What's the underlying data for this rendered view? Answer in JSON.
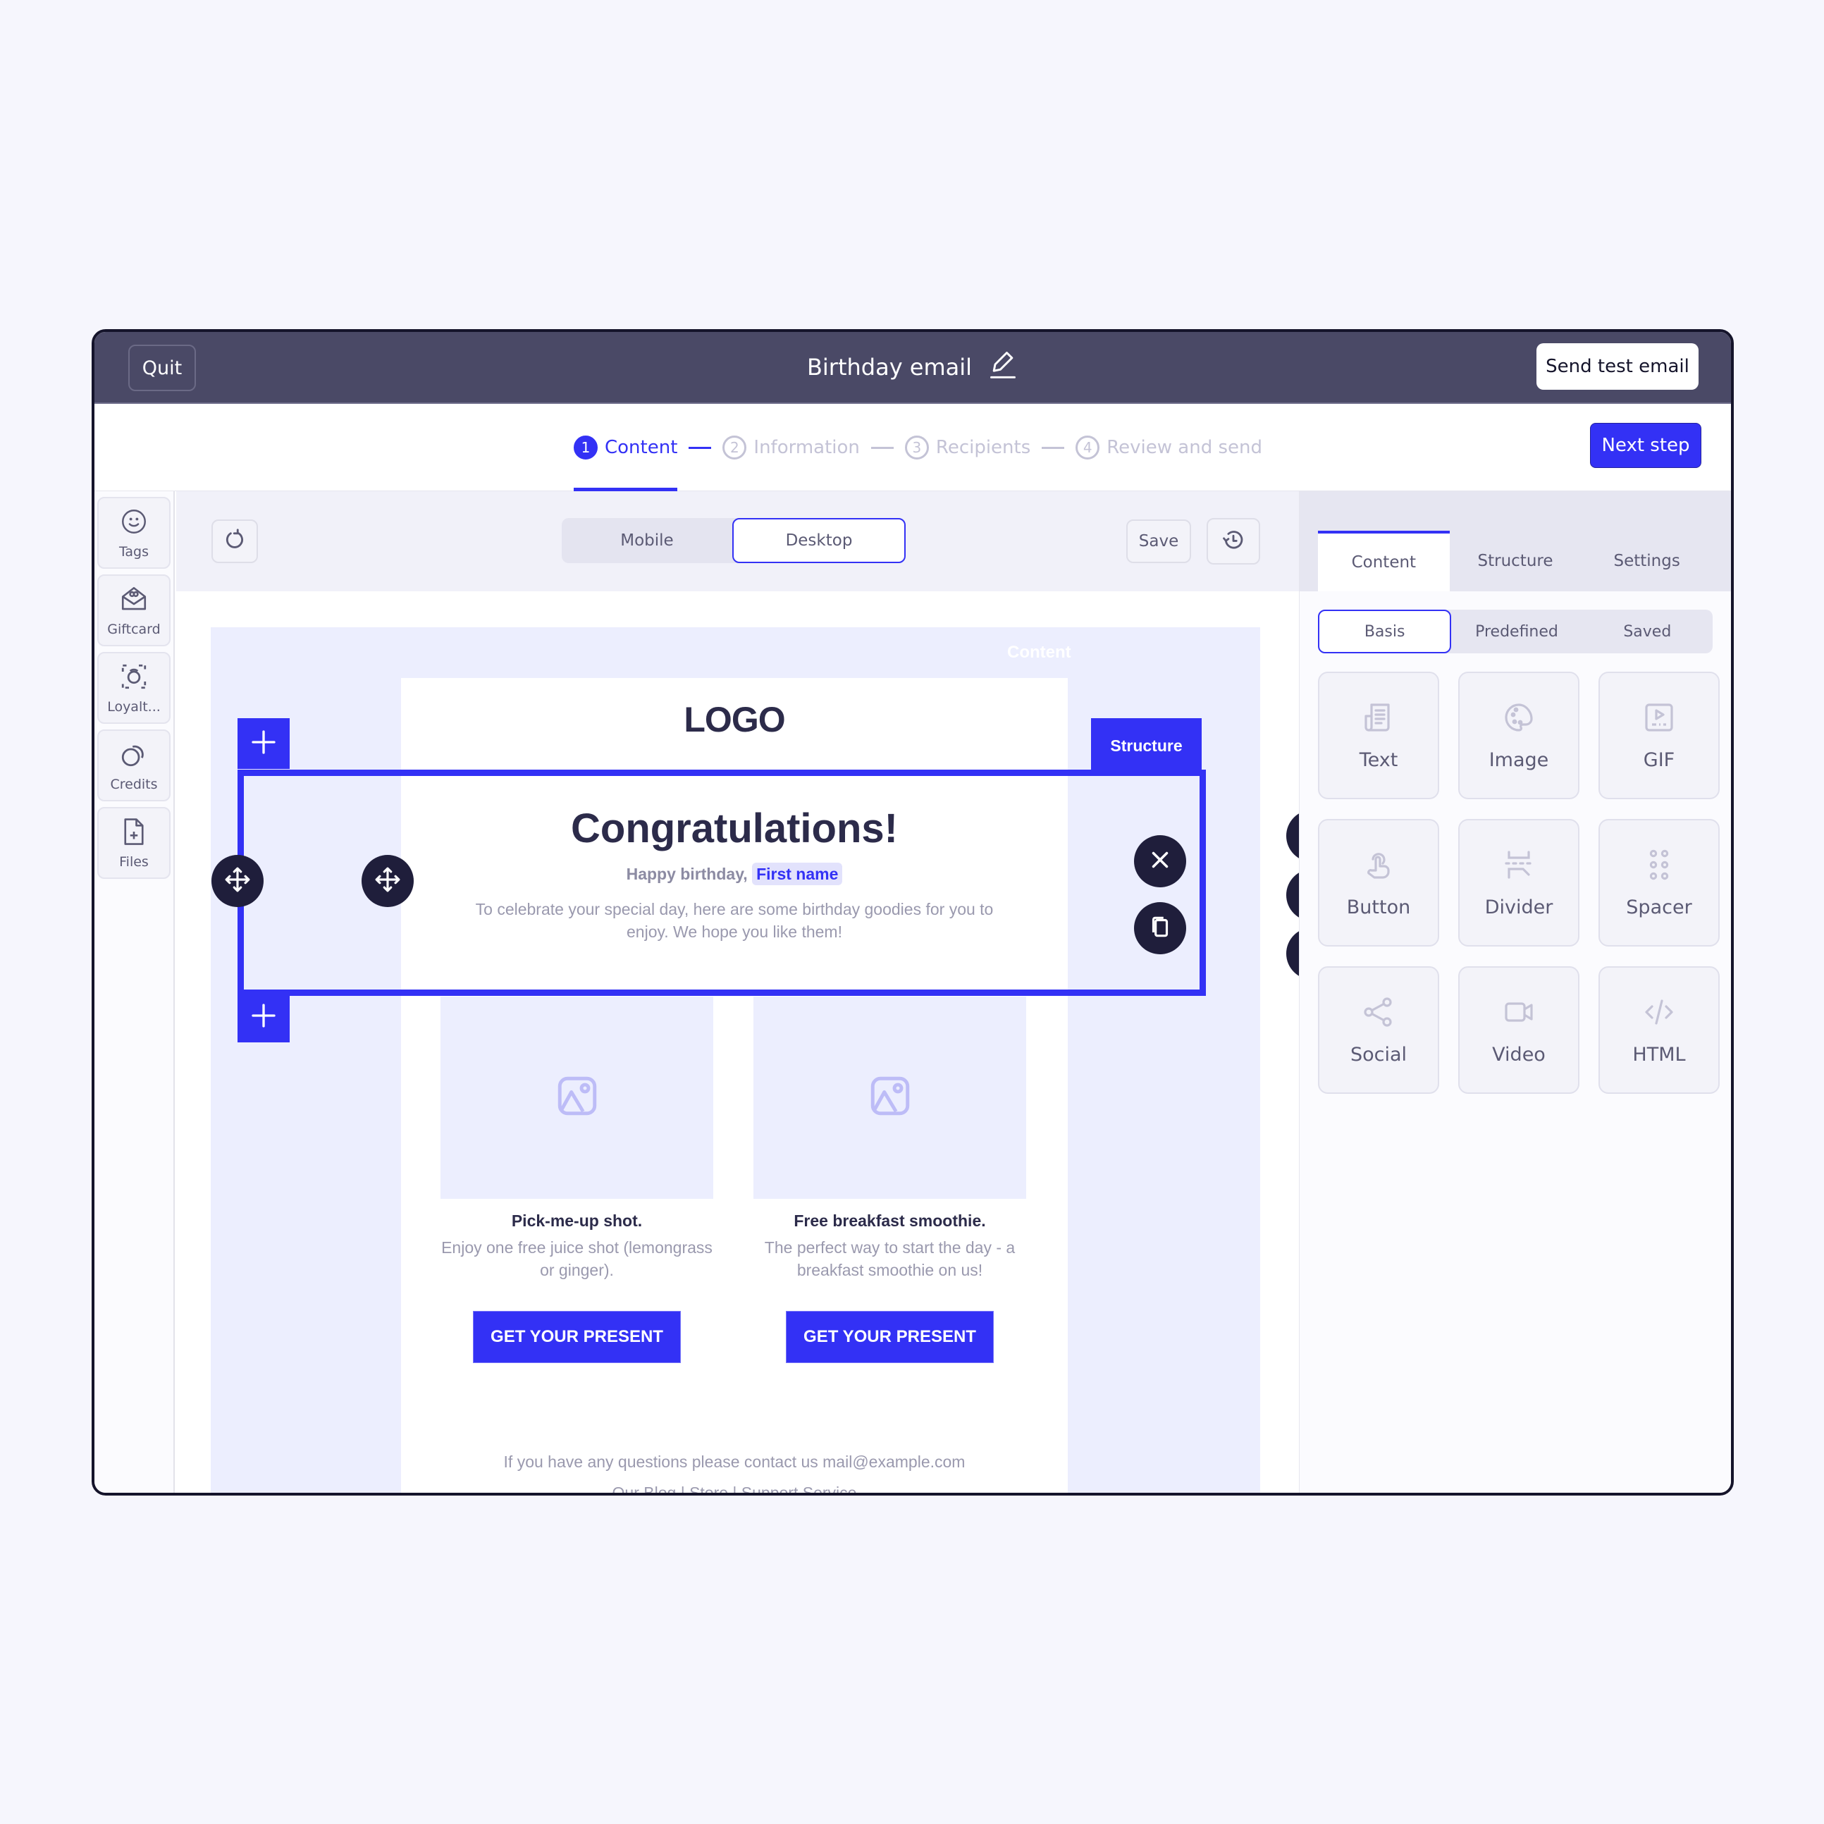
{
  "header": {
    "quit_label": "Quit",
    "title": "Birthday email",
    "title_edit_icon": "pencil-icon",
    "send_test_label": "Send test email"
  },
  "stepper": {
    "steps": [
      {
        "number": "1",
        "label": "Content",
        "state": "active"
      },
      {
        "number": "2",
        "label": "Information",
        "state": "inactive"
      },
      {
        "number": "3",
        "label": "Recipients",
        "state": "inactive"
      },
      {
        "number": "4",
        "label": "Review and send",
        "state": "inactive"
      }
    ],
    "next_label": "Next step"
  },
  "sidebar": {
    "items": [
      {
        "label": "Tags",
        "icon": "smiley-icon"
      },
      {
        "label": "Giftcard",
        "icon": "giftcard-icon"
      },
      {
        "label": "Loyalt...",
        "icon": "loyalty-icon"
      },
      {
        "label": "Credits",
        "icon": "credits-icon"
      },
      {
        "label": "Files",
        "icon": "file-add-icon"
      }
    ]
  },
  "toolbar": {
    "refresh_icon": "refresh-icon",
    "view_options": [
      "Mobile",
      "Desktop"
    ],
    "selected_view": "Desktop",
    "save_label": "Save",
    "history_icon": "history-icon"
  },
  "email": {
    "content_label": "Content",
    "logo": "LOGO",
    "heading": "Congratulations!",
    "greeting": "Happy birthday,",
    "first_name_tag": "First name",
    "intro": "To celebrate your special day, here are some birthday goodies for you to enjoy. We hope you like them!",
    "products": [
      {
        "title": "Pick-me-up shot.",
        "description": "Enjoy one free juice shot (lemongrass or ginger).",
        "cta": "GET YOUR PRESENT"
      },
      {
        "title": "Free breakfast smoothie.",
        "description": "The perfect way to start the day - a breakfast smoothie on us!",
        "cta": "GET YOUR PRESENT"
      }
    ],
    "footer_contact": "If you have any questions please contact us mail@example.com",
    "footer_links": "Our Blog | Store | Support Service"
  },
  "selection": {
    "structure_label": "Structure"
  },
  "right_panel": {
    "tabs": [
      "Content",
      "Structure",
      "Settings"
    ],
    "active_tab": "Content",
    "sub_tabs": [
      "Basis",
      "Predefined",
      "Saved"
    ],
    "active_sub_tab": "Basis",
    "blocks": [
      {
        "label": "Text",
        "icon": "text-icon"
      },
      {
        "label": "Image",
        "icon": "image-palette-icon"
      },
      {
        "label": "GIF",
        "icon": "gif-icon"
      },
      {
        "label": "Button",
        "icon": "button-tap-icon"
      },
      {
        "label": "Divider",
        "icon": "divider-icon"
      },
      {
        "label": "Spacer",
        "icon": "spacer-icon"
      },
      {
        "label": "Social",
        "icon": "share-icon"
      },
      {
        "label": "Video",
        "icon": "video-icon"
      },
      {
        "label": "HTML",
        "icon": "code-icon"
      }
    ]
  },
  "colors": {
    "accent": "#3331f5",
    "header_bg": "#4a4966",
    "dark_control": "#1f1e3b",
    "email_bg": "#eceefe"
  }
}
